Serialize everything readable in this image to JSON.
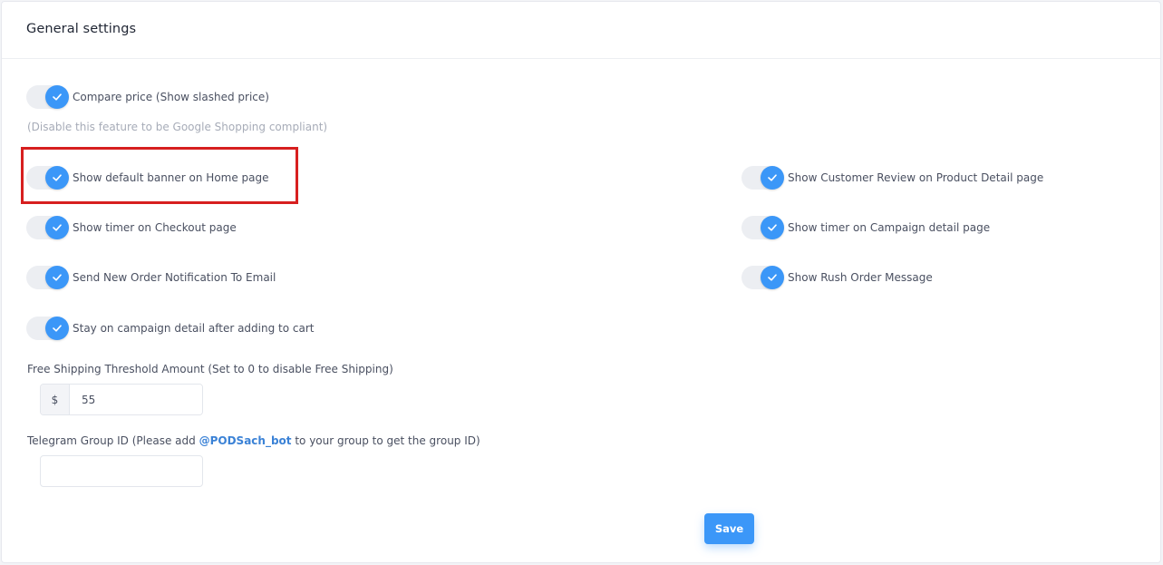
{
  "header": {
    "title": "General settings"
  },
  "toggles": {
    "compare_price": {
      "label": "Compare price (Show slashed price)",
      "on": true
    },
    "default_banner": {
      "label": "Show default banner on Home page",
      "on": true
    },
    "customer_review": {
      "label": "Show Customer Review on Product Detail page",
      "on": true
    },
    "timer_checkout": {
      "label": "Show timer on Checkout page",
      "on": true
    },
    "timer_campaign": {
      "label": "Show timer on Campaign detail page",
      "on": true
    },
    "order_notification": {
      "label": "Send New Order Notification To Email",
      "on": true
    },
    "rush_order": {
      "label": "Show Rush Order Message",
      "on": true
    },
    "stay_campaign": {
      "label": "Stay on campaign detail after adding to cart",
      "on": true
    }
  },
  "compare_price_hint": "(Disable this feature to be Google Shopping compliant)",
  "free_shipping": {
    "label": "Free Shipping Threshold Amount (Set to 0 to disable Free Shipping)",
    "currency": "$",
    "value": "55"
  },
  "telegram": {
    "label_before": "Telegram Group ID (Please add ",
    "bot_link": "@PODSach_bot",
    "label_after": " to your group to get the group ID)",
    "value": ""
  },
  "save_label": "Save",
  "colors": {
    "accent": "#3b97f8",
    "highlight": "#d71f1f"
  }
}
